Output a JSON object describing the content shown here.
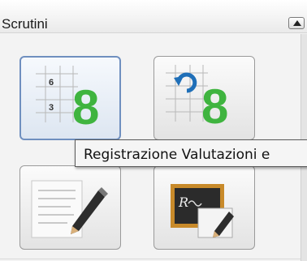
{
  "panel": {
    "title": "Scrutini"
  },
  "tiles": [
    {
      "name": "registrazione-valutazioni",
      "icon": "grid-grade-8-icon",
      "small_digits": [
        "6",
        "3"
      ],
      "big_digit": "8"
    },
    {
      "name": "aggiorna-valutazioni",
      "icon": "refresh-grade-8-icon",
      "big_digit": "8"
    },
    {
      "name": "note-giudizi",
      "icon": "document-pencil-icon"
    },
    {
      "name": "lavagna-pagella",
      "icon": "blackboard-icon",
      "board_text": "R"
    }
  ],
  "tooltip": {
    "text": "Registrazione Valutazioni e"
  },
  "colors": {
    "grade_green": "#3fb43f",
    "selected_border": "#6f8fbf",
    "refresh_blue": "#1f6fb8",
    "board_frame": "#c88a2a"
  }
}
